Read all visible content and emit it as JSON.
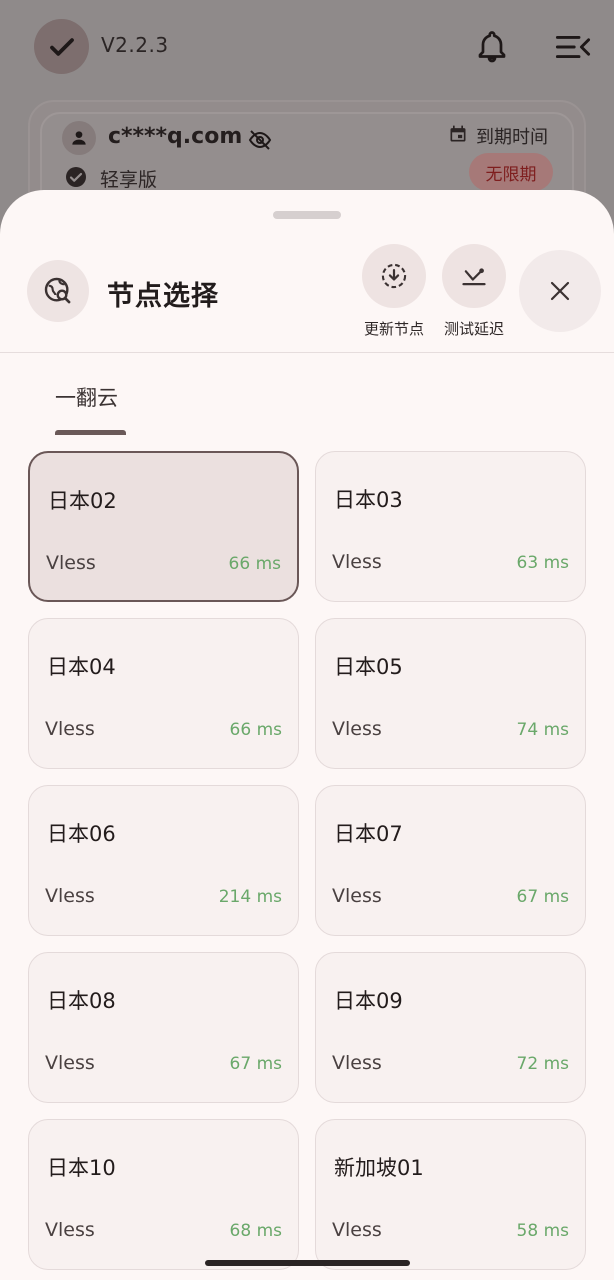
{
  "app": {
    "version": "V2.2.3"
  },
  "account": {
    "email": "c****q.com",
    "plan": "轻享版",
    "expire_label": "到期时间",
    "expire_value": "无限期"
  },
  "sheet": {
    "title": "节点选择",
    "actions": {
      "update_label": "更新节点",
      "test_label": "测试延迟"
    },
    "tab": "一翻云"
  },
  "nodes": [
    {
      "name": "日本02",
      "protocol": "Vless",
      "latency": "66 ms",
      "selected": true
    },
    {
      "name": "日本03",
      "protocol": "Vless",
      "latency": "63 ms"
    },
    {
      "name": "日本04",
      "protocol": "Vless",
      "latency": "66 ms"
    },
    {
      "name": "日本05",
      "protocol": "Vless",
      "latency": "74 ms"
    },
    {
      "name": "日本06",
      "protocol": "Vless",
      "latency": "214 ms"
    },
    {
      "name": "日本07",
      "protocol": "Vless",
      "latency": "67 ms"
    },
    {
      "name": "日本08",
      "protocol": "Vless",
      "latency": "67 ms"
    },
    {
      "name": "日本09",
      "protocol": "Vless",
      "latency": "72 ms"
    },
    {
      "name": "日本10",
      "protocol": "Vless",
      "latency": "68 ms"
    },
    {
      "name": "新加坡01",
      "protocol": "Vless",
      "latency": "58 ms"
    }
  ],
  "icons": {
    "logo": "check-icon",
    "notifications": "bell-icon",
    "menu": "menu-collapse-icon",
    "user": "person-icon",
    "visibility": "eye-off-icon",
    "plan": "verified-icon",
    "calendar": "calendar-icon",
    "sheet": "globe-search-icon",
    "update": "download-circle-icon",
    "test": "speed-test-icon",
    "close": "close-icon"
  },
  "colors": {
    "latency_good": "#6aa86a",
    "expire_badge": "#7e1e1e",
    "sheet_bg": "#fdf7f6"
  }
}
